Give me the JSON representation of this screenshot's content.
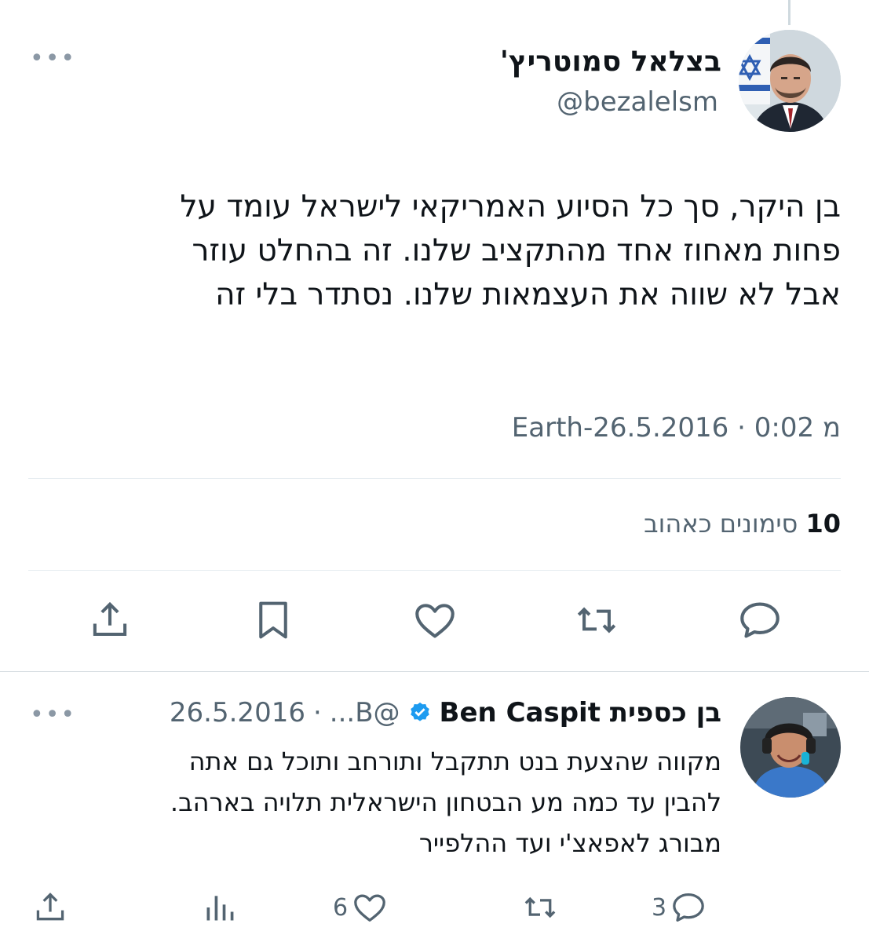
{
  "main_tweet": {
    "author_name": "בצלאל סמוטריץ'",
    "author_handle": "@bezalelsm",
    "text_lines": [
      "בן היקר, סך כל הסיוע האמריקאי לישראל עומד על",
      "פחות מאחוז אחד מהתקציב שלנו. זה בהחלט עוזר",
      "אבל לא שווה את העצמאות שלנו. נסתדר בלי זה"
    ],
    "timestamp": "Earth-מ 0:02 · 26.5.2016",
    "likes_count": "10",
    "likes_label": "סימונים כאהוב",
    "more_icon": "more-horizontal-icon",
    "actions": [
      "reply-icon",
      "retweet-icon",
      "like-icon",
      "bookmark-icon",
      "share-icon"
    ]
  },
  "reply_tweet": {
    "author_name": "בן כספית Ben Caspit",
    "author_handle": "@B...",
    "separator": "·",
    "date": "26.5.2016",
    "verified_icon": "verified-badge-icon",
    "text_lines": [
      "מקווה שהצעת בנט תתקבל ותורחב ותוכל גם אתה",
      "להבין עד כמה מע הבטחון הישראלית תלויה בארהב.",
      "מבורג לאפאצ'י ועד ההלפייר"
    ],
    "reply_count": "3",
    "like_count": "6",
    "actions": [
      "reply-icon",
      "retweet-icon",
      "like-icon",
      "views-icon",
      "share-icon"
    ]
  },
  "colors": {
    "text_primary": "#0f1419",
    "text_secondary": "#536471",
    "divider": "#e6ecf0",
    "verified_blue": "#1d9bf0"
  }
}
